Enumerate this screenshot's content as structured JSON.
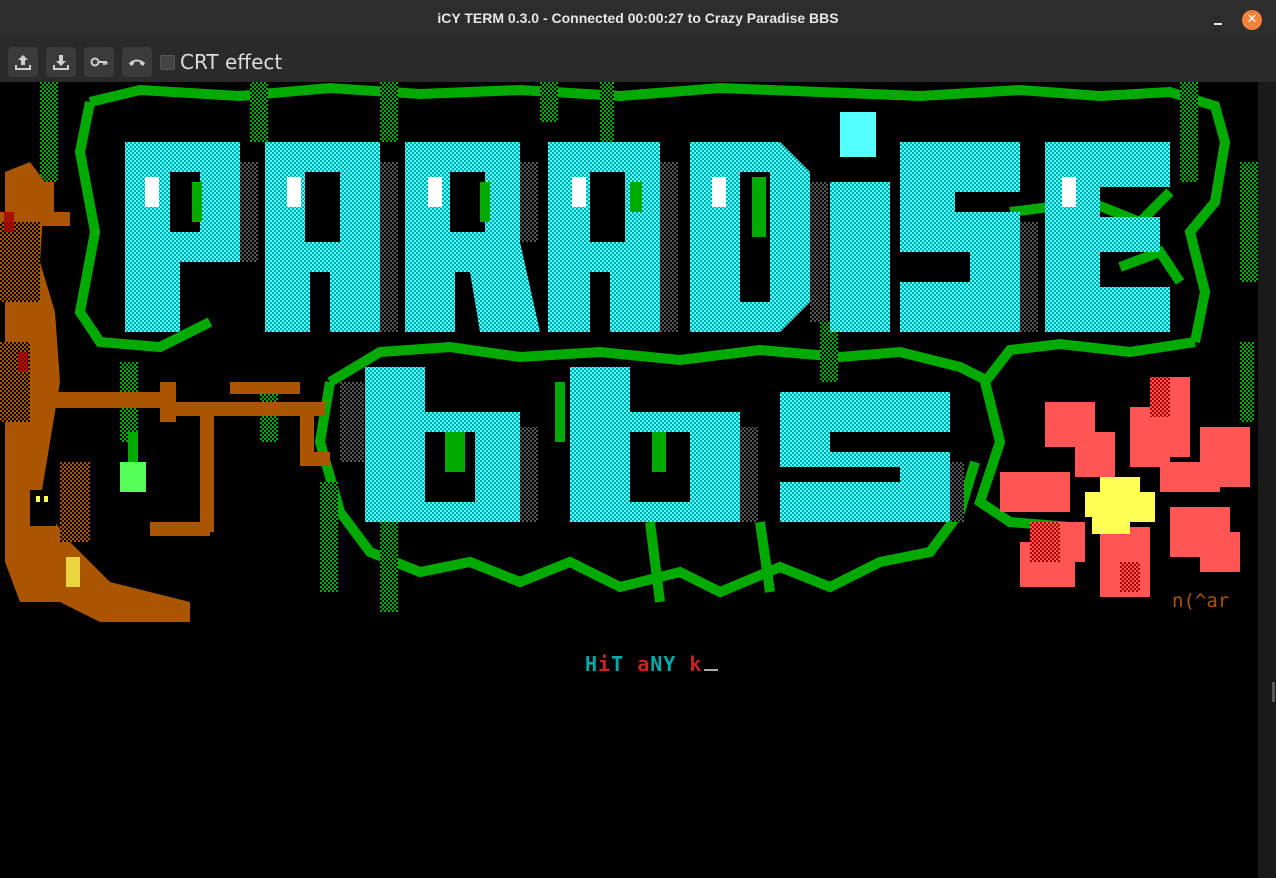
{
  "window": {
    "title": "iCY TERM 0.3.0 - Connected 00:00:27 to Crazy Paradise BBS",
    "close_glyph": "✕"
  },
  "toolbar": {
    "buttons": [
      {
        "icon": "upload-icon"
      },
      {
        "icon": "download-icon"
      },
      {
        "icon": "key-icon"
      },
      {
        "icon": "hangup-phone-icon"
      }
    ],
    "crt_label": "CRT effect",
    "crt_checked": false
  },
  "terminal": {
    "art_logo": "PARADiSE bbS",
    "signature": "n(^ar",
    "prompt_parts": [
      {
        "text": "H",
        "color": "#00aaaa"
      },
      {
        "text": "i",
        "color": "#cc2222"
      },
      {
        "text": "T",
        "color": "#00aaaa"
      },
      {
        "text": " ",
        "color": "#000000"
      },
      {
        "text": "a",
        "color": "#cc2222"
      },
      {
        "text": "N",
        "color": "#00aaaa"
      },
      {
        "text": "Y",
        "color": "#00aaaa"
      },
      {
        "text": " ",
        "color": "#000000"
      },
      {
        "text": "k",
        "color": "#cc2222"
      }
    ],
    "colors": {
      "cyan_light": "#55ffff",
      "cyan_dark": "#00aaaa",
      "green": "#00aa00",
      "green_light": "#55ff55",
      "brown": "#aa5500",
      "red_light": "#ff5555",
      "red_dark": "#aa0000",
      "yellow": "#ffff55",
      "gray": "#555555"
    }
  }
}
